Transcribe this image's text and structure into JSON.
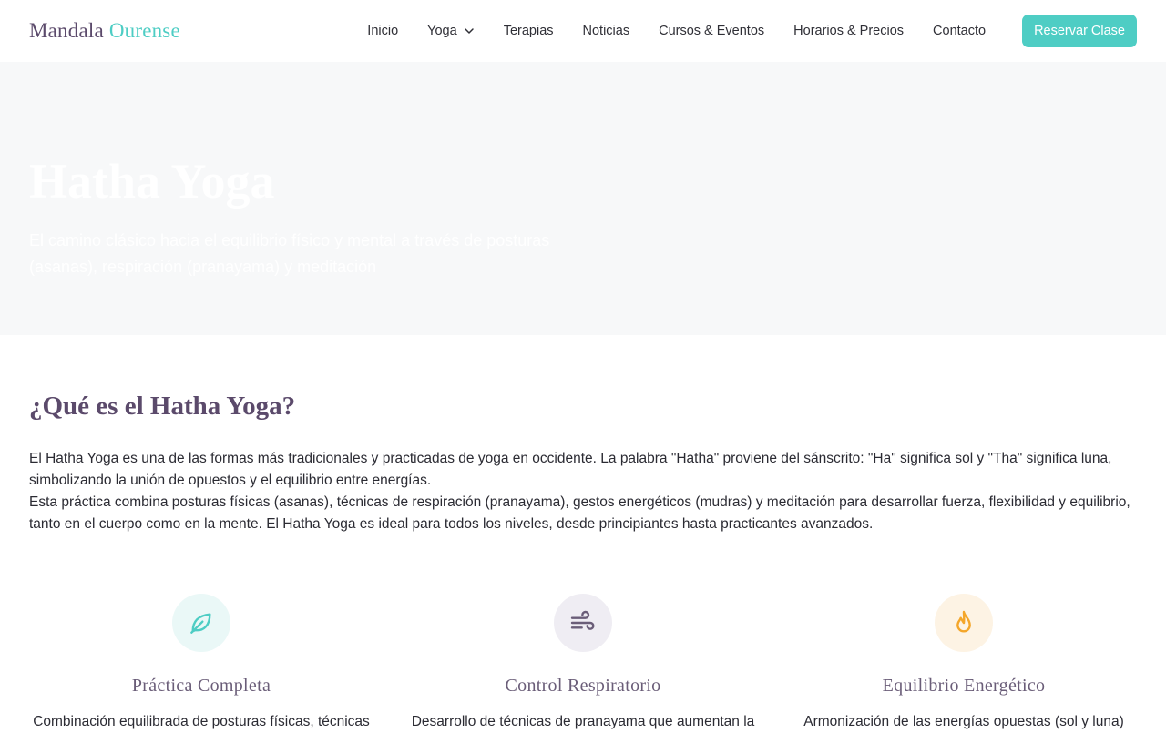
{
  "brand": {
    "part1": "Mandala",
    "part2": "Ourense"
  },
  "nav": {
    "items": [
      {
        "label": "Inicio"
      },
      {
        "label": "Yoga"
      },
      {
        "label": "Terapias"
      },
      {
        "label": "Noticias"
      },
      {
        "label": "Cursos & Eventos"
      },
      {
        "label": "Horarios & Precios"
      },
      {
        "label": "Contacto"
      }
    ],
    "cta_label": "Reservar Clase",
    "dropdown_icon": "chevron-down-icon"
  },
  "hero": {
    "title": "Hatha Yoga",
    "subtitle": "El camino clásico hacia el equilibrio físico y mental a través de posturas (asanas), respiración (pranayama) y meditación"
  },
  "about": {
    "title": "¿Qué es el Hatha Yoga?",
    "paragraph1": "El Hatha Yoga es una de las formas más tradicionales y practicadas de yoga en occidente. La palabra \"Hatha\" proviene del sánscrito: \"Ha\" significa sol y \"Tha\" significa luna, simbolizando la unión de opuestos y el equilibrio entre energías.",
    "paragraph2": "Esta práctica combina posturas físicas (asanas), técnicas de respiración (pranayama), gestos energéticos (mudras) y meditación para desarrollar fuerza, flexibilidad y equilibrio, tanto en el cuerpo como en la mente. El Hatha Yoga es ideal para todos los niveles, desde principiantes hasta practicantes avanzados."
  },
  "features": [
    {
      "icon": "leaf-icon",
      "title": "Práctica Completa",
      "desc": "Combinación equilibrada de posturas físicas, técnicas"
    },
    {
      "icon": "wind-icon",
      "title": "Control Respiratorio",
      "desc": "Desarrollo de técnicas de pranayama que aumentan la"
    },
    {
      "icon": "flame-icon",
      "title": "Equilibrio Energético",
      "desc": "Armonización de las energías opuestas (sol y luna)"
    }
  ],
  "colors": {
    "accent": "#4ecdc4",
    "brand_purple": "#5b4a6b",
    "hero_bg": "#f7f8f9",
    "feature_circle_1": "#eaf8f7",
    "feature_circle_2": "#efedf3",
    "feature_circle_3": "#fdf3e4",
    "flame": "#f4a62a"
  }
}
